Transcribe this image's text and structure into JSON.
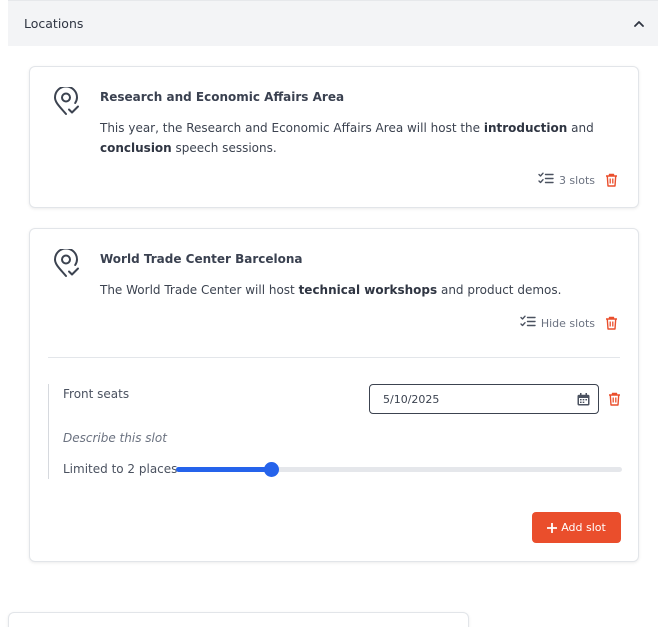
{
  "section": {
    "title": "Locations"
  },
  "locations": [
    {
      "title": "Research and Economic Affairs Area",
      "desc_1": "This year, the Research and Economic Affairs Area will host the ",
      "desc_bold_1": "introduction",
      "desc_2": " and ",
      "desc_bold_2": "conclusion",
      "desc_3": " speech sessions.",
      "slots_label": "3 slots"
    },
    {
      "title": "World Trade Center Barcelona",
      "desc_1": "The World Trade Center will host ",
      "desc_bold_1": "technical workshops",
      "desc_2": " and product demos.",
      "slots_label": "Hide slots",
      "slot": {
        "name": "Front seats",
        "date": "5/10/2025",
        "description_placeholder": "Describe this slot",
        "limit_label": "Limited to 2 places",
        "slider_fraction": 0.212
      },
      "add_slot_label": "Add slot"
    }
  ],
  "colors": {
    "accent": "#2563eb",
    "danger": "#ea4e2c",
    "text": "#3c4350"
  }
}
